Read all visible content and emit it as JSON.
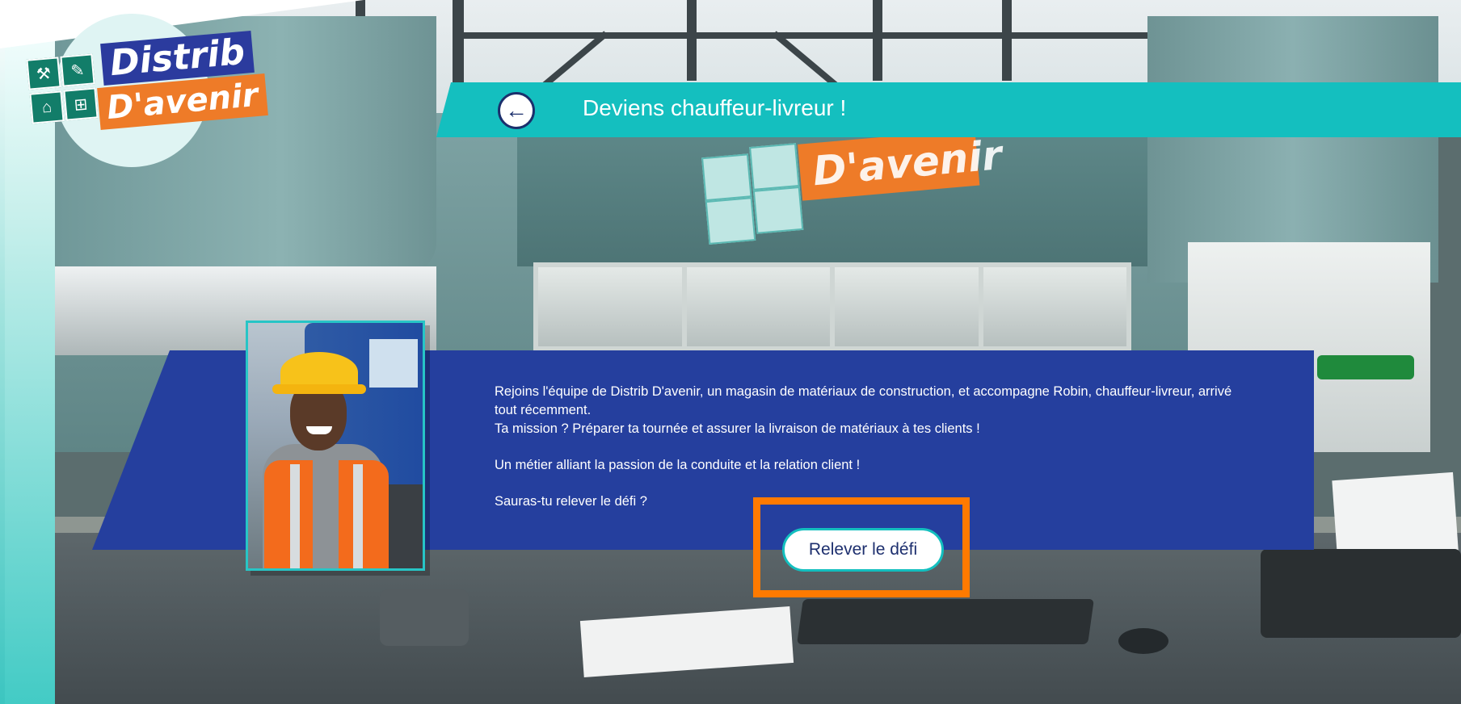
{
  "app": {
    "logo_line1": "Distrib",
    "logo_line2": "D'avenir",
    "logo_tile_icons": [
      "drill-icon",
      "paint-brush-icon",
      "trowel-icon",
      "tile-grid-icon"
    ]
  },
  "header": {
    "title": "Deviens chauffeur-livreur !",
    "back_icon": "arrow-left-icon",
    "back_glyph": "←"
  },
  "background": {
    "store_sign_text": "D'avenir"
  },
  "intro": {
    "paragraph1": "Rejoins l'équipe de Distrib D'avenir, un magasin de matériaux de construction, et accompagne Robin, chauffeur-livreur, arrivé tout récemment.",
    "paragraph2": "Ta mission ? Préparer ta tournée et assurer la livraison de matériaux à tes clients !",
    "paragraph3": "Un métier alliant la passion de la conduite et la relation client !",
    "paragraph4": "Sauras-tu relever le défi ?"
  },
  "cta": {
    "label": "Relever le défi"
  },
  "colors": {
    "teal": "#14bfbf",
    "navy_panel": "#253f9e",
    "highlight_orange": "#ff7a00",
    "brand_orange": "#ee7b28",
    "brand_blue": "#2b3b9e"
  }
}
